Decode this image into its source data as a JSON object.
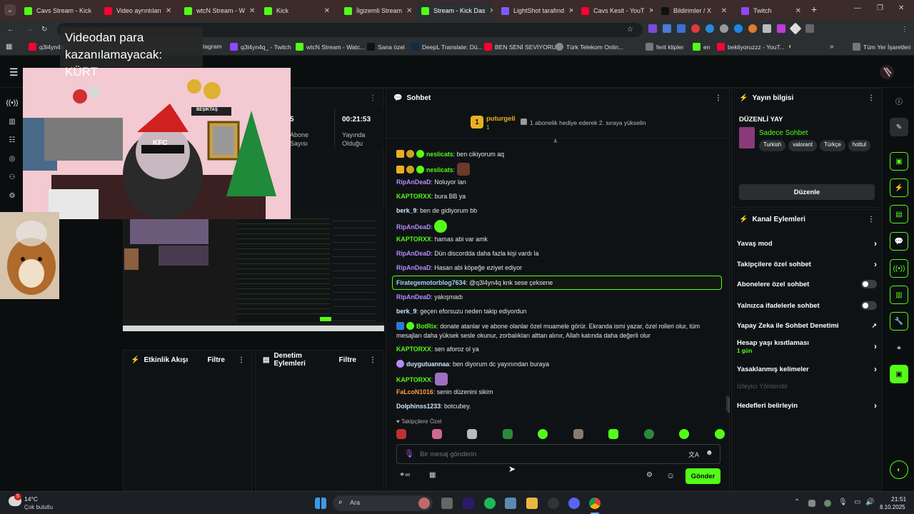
{
  "browser": {
    "tabs": [
      {
        "title": "Cavs Stream - Kick",
        "color": "#53fc18"
      },
      {
        "title": "Video ayrıntıları",
        "color": "#ff0033"
      },
      {
        "title": "wtcN Stream - W",
        "color": "#53fc18"
      },
      {
        "title": "Kick",
        "color": "#53fc18"
      },
      {
        "title": "İlgizemli Stream",
        "color": "#53fc18"
      },
      {
        "title": "Stream - Kick Das",
        "color": "#53fc18"
      },
      {
        "title": "LightShot tarafınd",
        "color": "#7b5cff"
      },
      {
        "title": "Cavs Kesit - YouT",
        "color": "#ff0033"
      },
      {
        "title": "Bildirimler / X",
        "color": "#111111"
      },
      {
        "title": "Twitch",
        "color": "#9146ff"
      }
    ],
    "new_tab": "+",
    "bookmarks": [
      {
        "label": "q3l4yn4q",
        "color": "#ff0033"
      },
      {
        "label": "tagram",
        "color": "#e1306c"
      },
      {
        "label": "q3l4yn4q_ - Twitch",
        "color": "#9146ff"
      },
      {
        "label": "wtcN Stream - Watc...",
        "color": "#53fc18"
      },
      {
        "label": "Sana özel",
        "color": "#111111"
      },
      {
        "label": "DeepL Translate: Dü...",
        "color": "#0f2b46"
      },
      {
        "label": "BEN SENİ SEVİYORU...",
        "color": "#ff0033"
      },
      {
        "label": "Türk Telekom Onlin...",
        "color": "#888888"
      },
      {
        "label": "ferit klipler",
        "color": "#777777"
      },
      {
        "label": "en",
        "color": "#53fc18"
      },
      {
        "label": "bekliyoruzzz - YouT...",
        "color": "#ff0033"
      },
      {
        "label": "Tüm Yer İşaretleri",
        "color": "#777777"
      }
    ]
  },
  "overlay": {
    "monetization_notice": "Videodan para kazanılamayacak: KÜRT",
    "stream_banner_text": "BEŞİKTAŞ",
    "kfc_text": "KFC"
  },
  "stats": {
    "sub_count_label": "Abone Sayısı",
    "sub_count_value": "5",
    "live_time": "00:21:53",
    "live_label": "Yayında Olduğu"
  },
  "panels": {
    "activity": {
      "title": "Etkinlik Akışı",
      "filter": "Filtre"
    },
    "moderation": {
      "title": "Denetim Eylemleri",
      "filter": "Filtre"
    }
  },
  "chat": {
    "title": "Sohbet",
    "pinned_user": "puturgeli",
    "pinned_rank": "1",
    "pinned_count": "1",
    "gift_text": "1 abonelik hediye ederek 2. sıraya yükselin",
    "messages": [
      {
        "user": "neslicats",
        "text": ": ben cikiyorum aq",
        "color": "#53fc18"
      },
      {
        "user": "neslicats",
        "text": ":",
        "color": "#53fc18"
      },
      {
        "user": "RipAnDeaD",
        "text": ": Noluyor lan",
        "color": "#b58cff"
      },
      {
        "user": "KAPTORXX",
        "text": ": bura BB ya",
        "color": "#53fc18"
      },
      {
        "user": "berk_9",
        "text": ": ben de gidiyorum bb",
        "color": "#cde8ff"
      },
      {
        "user": "RipAnDeaD",
        "text": ":",
        "color": "#b58cff"
      },
      {
        "user": "KAPTORXX",
        "text": ": hamas abi var amk",
        "color": "#53fc18"
      },
      {
        "user": "RipAnDeaD",
        "text": ": Dün discordda daha fazla kişi vardı la",
        "color": "#b58cff"
      },
      {
        "user": "RipAnDeaD",
        "text": ": Hasan abi köpeğe eziyet ediyor",
        "color": "#b58cff"
      },
      {
        "user": "Firategemotorblog7634",
        "text": ": @q3l4yn4q knk sese çeksene",
        "color": "#9bd3ff"
      },
      {
        "user": "RipAnDeaD",
        "text": ": yakışmadı",
        "color": "#b58cff"
      },
      {
        "user": "berk_9",
        "text": ": geçen eforsuzu neden takip ediyordun",
        "color": "#cde8ff"
      },
      {
        "user": "BotRix",
        "text": ": donate atanlar ve abone olanlar özel muamele görür. Ekranda ismi yazar, özel rolleri olur, tüm",
        "color": "#53fc18"
      },
      {
        "user": "",
        "text": "mesajları daha yüksek sesle okunur, zorbalıkları alttan alınır, Allah katında daha değerli olur",
        "color": "#ffffff"
      },
      {
        "user": "KAPTORXX",
        "text": ": sen aforoz ol ya",
        "color": "#53fc18"
      },
      {
        "user": "duygutuannaa",
        "text": ": ben diyorum dc yayınından buraya",
        "color": "#cde8ff"
      },
      {
        "user": "KAPTORXX",
        "text": ":",
        "color": "#53fc18"
      },
      {
        "user": "FaLcoN1016",
        "text": ": senin düzenini sikim",
        "color": "#ff9d3c"
      },
      {
        "user": "Dolphinss1233",
        "text": ": botcubey.",
        "color": "#cde8ff"
      }
    ],
    "followers_only_label": "Takipçilere Özel",
    "input_placeholder": "Bir mesaj gönderin",
    "send_label": "Gönder"
  },
  "stream_info": {
    "title": "Yayın bilgisi",
    "edit_header": "DÜZENLİ YAY",
    "category": "Sadece Sohbet",
    "tags": [
      "Turkish",
      "valorant",
      "Türkçe",
      "hottul"
    ],
    "edit_button": "Düzenle"
  },
  "channel_actions": {
    "title": "Kanal Eylemleri",
    "items": [
      {
        "label": "Yavaş mod",
        "control": "chevron"
      },
      {
        "label": "Takipçilere özel sohbet",
        "control": "chevron"
      },
      {
        "label": "Abonelere özel sohbet",
        "control": "toggle"
      },
      {
        "label": "Yalnızca ifadelerle sohbet",
        "control": "toggle"
      },
      {
        "label": "Yapay Zeka ile Sohbet Denetimi",
        "control": "external"
      },
      {
        "label": "Hesap yaşı kısıtlaması",
        "control": "chevron",
        "sub": "1 gün"
      },
      {
        "label": "Yasaklanmış kelimeler",
        "control": "chevron"
      },
      {
        "label": "İzleyici Yönlendir",
        "control": "none"
      },
      {
        "label": "Hedefleri belirleyin",
        "control": "chevron"
      }
    ]
  },
  "taskbar": {
    "weather_temp": "14°C",
    "weather_desc": "Çok bulutlu",
    "search": "Ara",
    "time": "21:51",
    "date": "8.10.2025",
    "notif_count": "5"
  },
  "colors": {
    "kick_green": "#53fc18",
    "bg": "#0b0e0f",
    "panel": "#0f1214"
  }
}
